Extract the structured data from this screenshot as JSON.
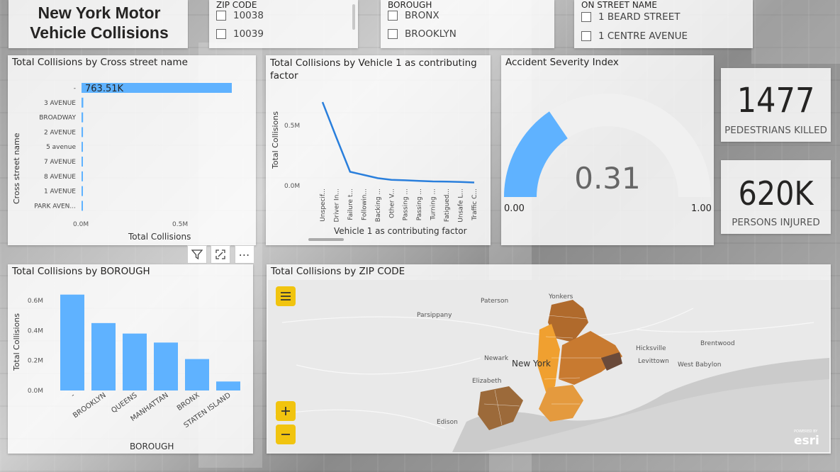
{
  "title": "New York Motor Vehicle Collisions",
  "slicers": {
    "zip": {
      "title": "ZIP CODE",
      "items": [
        "10038",
        "10039"
      ]
    },
    "borough": {
      "title": "BOROUGH",
      "items": [
        "BRONX",
        "BROOKLYN"
      ]
    },
    "street": {
      "title": "ON STREET NAME",
      "items": [
        "1 BEARD STREET",
        "1 CENTRE AVENUE"
      ]
    }
  },
  "cross_street": {
    "title": "Total Collisions by Cross street name",
    "ylabel": "Cross street name",
    "xlabel": "Total Collisions",
    "data_label": "763.51K",
    "ticks": [
      "0.0M",
      "0.5M"
    ]
  },
  "vehicle": {
    "title": "Total Collisions by Vehicle 1 as contributing factor",
    "ylabel": "Total Collisions",
    "xlabel": "Vehicle 1 as contributing factor",
    "yticks": [
      "0.5M",
      "0.0M"
    ]
  },
  "severity": {
    "title": "Accident Severity Index",
    "value": "0.31",
    "min": "0.00",
    "max": "1.00",
    "fraction": 0.31,
    "fill_color": "#5fb2ff",
    "track_color": "#f0f0f0"
  },
  "kpi_killed": {
    "value": "1477",
    "label": "PEDESTRIANS KILLED"
  },
  "kpi_injured": {
    "value": "620K",
    "label": "PERSONS INJURED"
  },
  "borough_chart": {
    "title": "Total Collisions by BOROUGH",
    "ylabel": "Total Collisions",
    "xlabel": "BOROUGH",
    "yticks": [
      "0.6M",
      "0.4M",
      "0.2M",
      "0.0M"
    ]
  },
  "zip_map": {
    "title": "Total Collisions by ZIP CODE",
    "places": [
      "Yonkers",
      "Paterson",
      "Parsippany",
      "Hicksville",
      "Brentwood",
      "Newark",
      "Levittown",
      "West Babylon",
      "New York",
      "Elizabeth",
      "Edison"
    ],
    "logo": "esri",
    "logo_small": "POWERED BY"
  },
  "accent_color": "#5fb2ff",
  "map_button_color": "#f1c40f",
  "chart_data": [
    {
      "type": "bar",
      "orientation": "horizontal",
      "title": "Total Collisions by Cross street name",
      "categories": [
        "-",
        "3 AVENUE",
        "BROADWAY",
        "2 AVENUE",
        "5 avenue",
        "7 AVENUE",
        "8 AVENUE",
        "1 AVENUE",
        "PARK AVEN..."
      ],
      "values": [
        763510,
        9000,
        8000,
        7500,
        7000,
        6500,
        6200,
        6000,
        5500
      ],
      "xlabel": "Total Collisions",
      "ylabel": "Cross street name"
    },
    {
      "type": "line",
      "title": "Total Collisions by Vehicle 1 as contributing factor",
      "categories": [
        "Unspecif...",
        "Driver In...",
        "Failure t...",
        "Followin...",
        "Backing ...",
        "Other V...",
        "Passing ...",
        "Passing ...",
        "Turning ...",
        "Fatigued...",
        "Unsafe L...",
        "Traffic C..."
      ],
      "values": [
        780000,
        450000,
        130000,
        100000,
        70000,
        55000,
        50000,
        45000,
        40000,
        38000,
        35000,
        30000
      ],
      "xlabel": "Vehicle 1 as contributing factor",
      "ylabel": "Total Collisions",
      "ylim": [
        0,
        900000
      ]
    },
    {
      "type": "bar",
      "title": "Total Collisions by BOROUGH",
      "categories": [
        "-",
        "BROOKLYN",
        "QUEENS",
        "MANHATTAN",
        "BRONX",
        "STATEN ISLAND"
      ],
      "values": [
        640000,
        450000,
        380000,
        320000,
        210000,
        60000
      ],
      "xlabel": "BOROUGH",
      "ylabel": "Total Collisions",
      "ylim": [
        0,
        700000
      ]
    }
  ]
}
